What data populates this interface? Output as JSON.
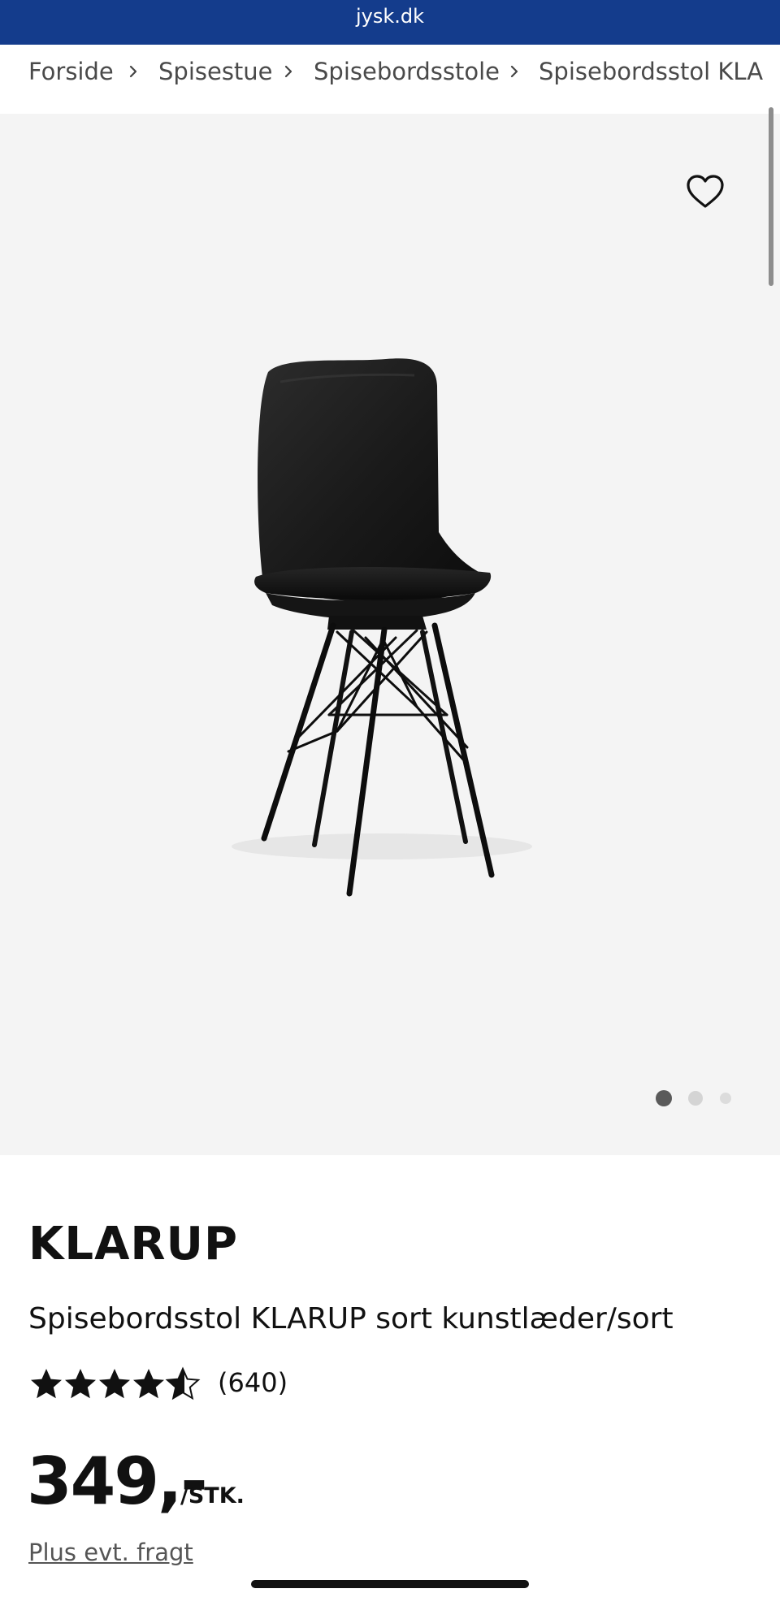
{
  "browser": {
    "url": "jysk.dk"
  },
  "breadcrumb": {
    "items": [
      "Forside",
      "Spisestue",
      "Spisebordsstole",
      "Spisebordsstol KLA"
    ]
  },
  "gallery": {
    "image_count": 3,
    "active_index": 0
  },
  "product": {
    "name": "KLARUP",
    "description": "Spisebordsstol KLARUP sort kunstlæder/sort",
    "rating": 4.5,
    "rating_max": 5,
    "review_count": "(640)",
    "price": "349,-",
    "price_unit": "/STK.",
    "shipping_note": "Plus evt. fragt"
  },
  "colors": {
    "brand": "#143C8C",
    "text": "#111111",
    "gallery_bg": "#f4f4f4"
  },
  "icons": [
    "chevron-right-icon",
    "heart-icon",
    "star-icon"
  ]
}
